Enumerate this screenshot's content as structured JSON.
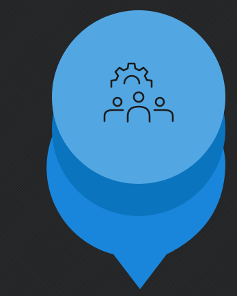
{
  "graphic": {
    "icon": "team-gear-icon",
    "colors": {
      "background": "#262729",
      "pin_outer": "#1a86db",
      "pin_ring": "#0b74bf",
      "pin_inner": "#52a7e3",
      "icon_stroke": "#1c1c1c"
    }
  }
}
